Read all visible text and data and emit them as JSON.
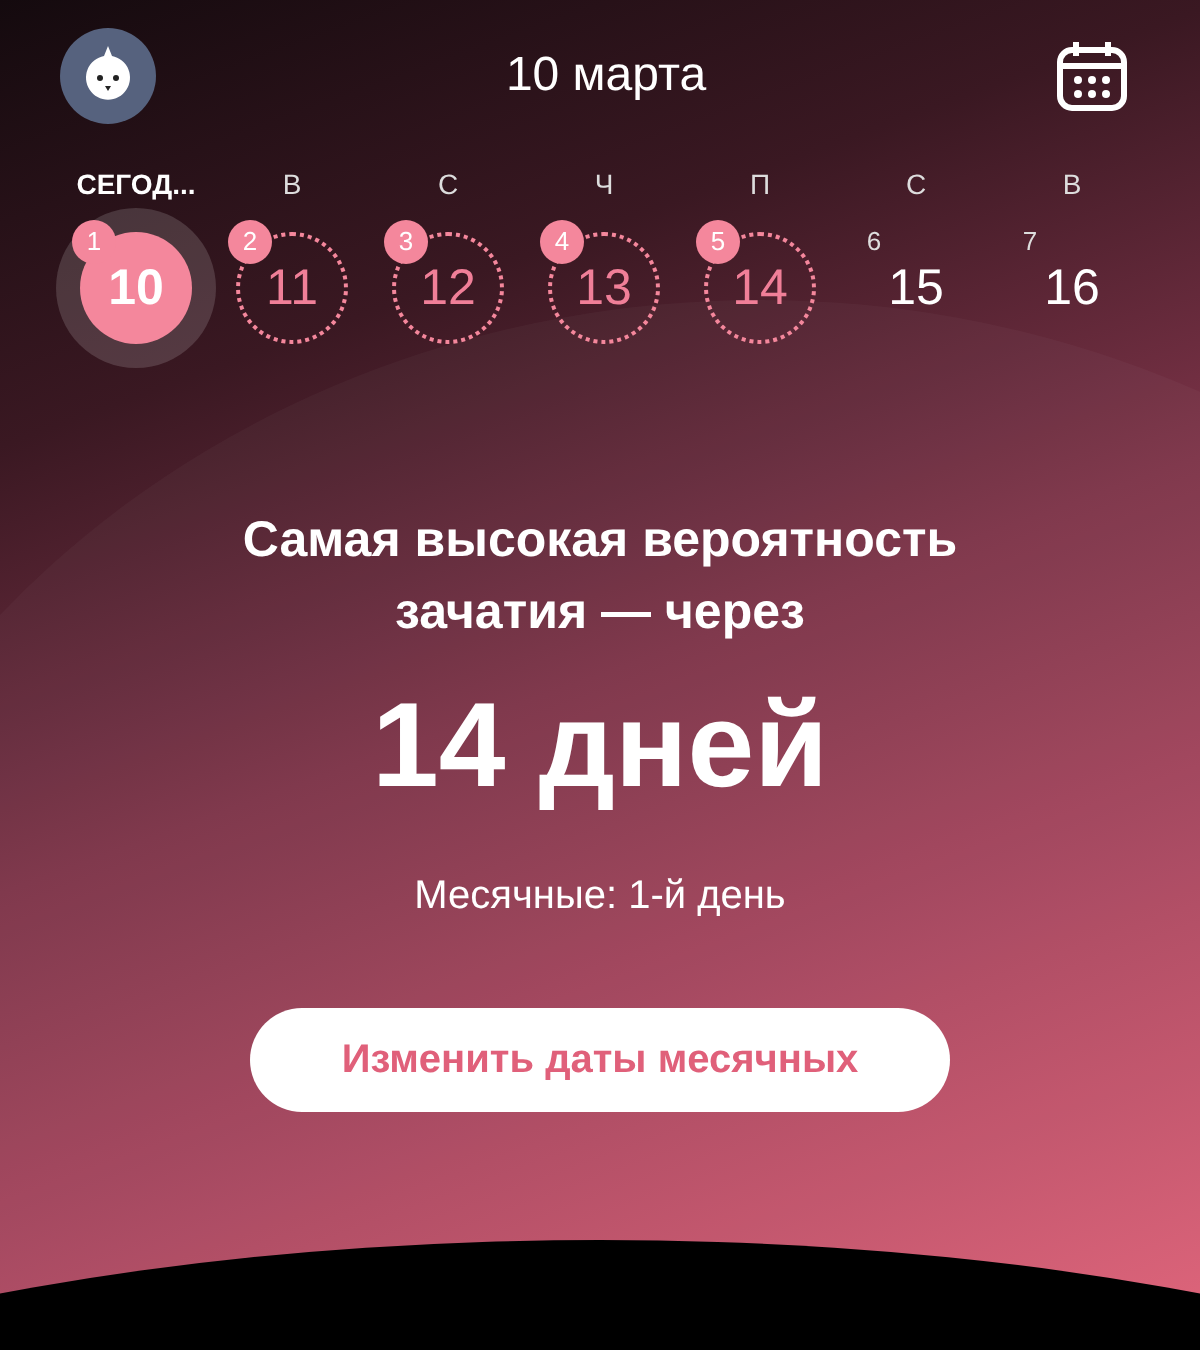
{
  "header": {
    "title": "10 марта"
  },
  "days": [
    {
      "weekday": "СЕГОД...",
      "cycle_day": "1",
      "date": "10",
      "kind": "period",
      "selected": true
    },
    {
      "weekday": "В",
      "cycle_day": "2",
      "date": "11",
      "kind": "period",
      "selected": false
    },
    {
      "weekday": "С",
      "cycle_day": "3",
      "date": "12",
      "kind": "period",
      "selected": false
    },
    {
      "weekday": "Ч",
      "cycle_day": "4",
      "date": "13",
      "kind": "period",
      "selected": false
    },
    {
      "weekday": "П",
      "cycle_day": "5",
      "date": "14",
      "kind": "period",
      "selected": false
    },
    {
      "weekday": "С",
      "cycle_day": "6",
      "date": "15",
      "kind": "plain",
      "selected": false
    },
    {
      "weekday": "В",
      "cycle_day": "7",
      "date": "16",
      "kind": "plain",
      "selected": false
    }
  ],
  "summary": {
    "headline": "Самая высокая вероятность зачатия — через",
    "countdown": "14 дней",
    "period_status": "Месячные: 1-й день",
    "button": "Изменить даты месячных"
  }
}
